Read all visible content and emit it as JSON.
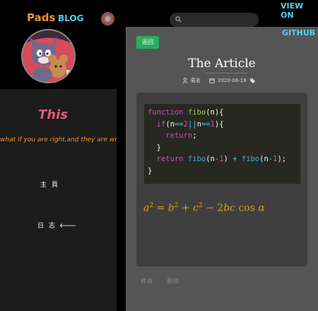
{
  "header": {
    "brand": "Pads",
    "blog_link": "BLOG",
    "search_placeholder": "",
    "view_on": "VIEW ON",
    "github": "GITHUB"
  },
  "sidebar": {
    "title": "This",
    "motto": "what if you are right,and they are wrong",
    "nav": {
      "home": "主 頁",
      "log": "日 志"
    }
  },
  "article": {
    "back_button": "返回",
    "title": "The Article",
    "author": "匿名",
    "date": "2020-06-18",
    "code_lines": [
      "function fibo(n){",
      "  if(n==2||n==1){",
      "    return;",
      "  }",
      "  return fibo(n-1) + fibo(n-1);",
      "}"
    ],
    "formula": "a² = b² + c² − 2bc cos α",
    "footer_links": [
      "修改",
      "删除"
    ]
  },
  "colors": {
    "brand": "#f0932b",
    "link": "#4fd1e8",
    "back_button": "#27ae60",
    "formula": "#d4a020"
  }
}
